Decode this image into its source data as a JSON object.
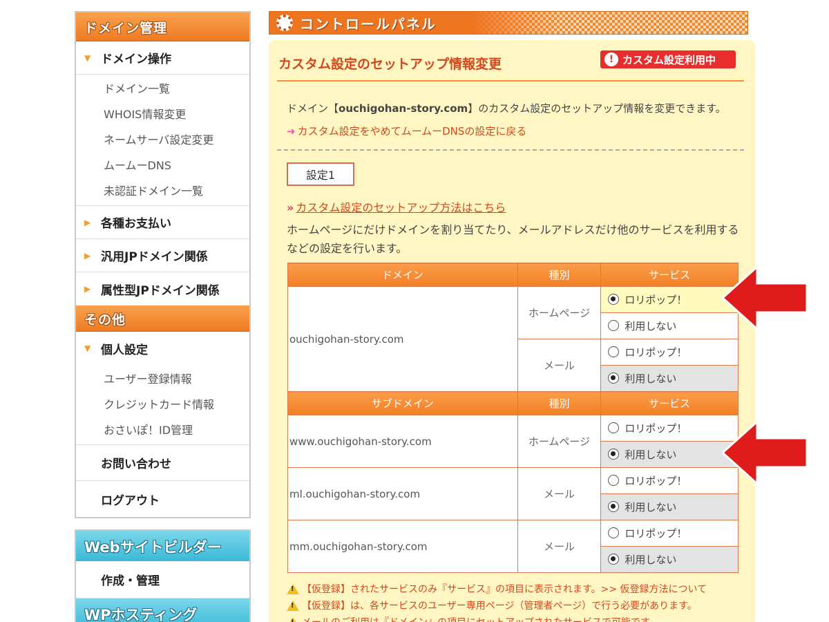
{
  "sidebar": {
    "domain_header": "ドメイン管理",
    "domain_ops": "ドメイン操作",
    "domain_items": [
      "ドメイン一覧",
      "WHOIS情報変更",
      "ネームサーバ設定変更",
      "ムームーDNS",
      "未認証ドメイン一覧"
    ],
    "payments": "各種お支払い",
    "generic_jp": "汎用JPドメイン関係",
    "attr_jp": "属性型JPドメイン関係",
    "other_header": "その他",
    "personal": "個人設定",
    "personal_items": [
      "ユーザー登録情報",
      "クレジットカード情報",
      "おさいぽ！ID管理"
    ],
    "contact": "お問い合わせ",
    "logout": "ログアウト",
    "web_builder_header": "Webサイトビルダー",
    "web_builder_item": "作成・管理",
    "wp_header": "WPホスティング"
  },
  "banner": {
    "title": "コントロールパネル"
  },
  "main": {
    "title": "カスタム設定のセットアップ情報変更",
    "badge": "カスタム設定利用中",
    "desc_prefix": "ドメイン【",
    "desc_domain": "ouchigohan-story.com",
    "desc_suffix": "】のカスタム設定のセットアップ情報を変更できます。",
    "back_link": "カスタム設定をやめてムームーDNSの設定に戻る",
    "tab": "設定1",
    "setup_link": "カスタム設定のセットアップ方法はこちら",
    "note": "ホームページにだけドメインを割り当てたり、メールアドレスだけ他のサービスを利用するなどの設定を行います。"
  },
  "table": {
    "h_domain": "ドメイン",
    "h_kind": "種別",
    "h_service": "サービス",
    "h_subdomain": "サブドメイン",
    "kind_homepage": "ホームページ",
    "kind_mail": "メール",
    "opt_lolipop": "ロリポップ！",
    "opt_none": "利用しない",
    "domain": "ouchigohan-story.com",
    "sub1": "www.ouchigohan-story.com",
    "sub2": "ml.ouchigohan-story.com",
    "sub3": "mm.ouchigohan-story.com"
  },
  "warnings": {
    "w1": "【仮登録】されたサービスのみ『サービス』の項目に表示されます。",
    "w1_link": ">> 仮登録方法について",
    "w2": "【仮登録】は、各サービスのユーザー専用ページ（管理者ページ）で行う必要があります。",
    "w3": "メールのご利用は『ドメイン』の項目にセットアップされたサービスで可能です。"
  },
  "colors": {
    "accent_orange": "#ee7b22",
    "panel_bg": "#fff6c4",
    "red_arrow": "#e01b1b",
    "link": "#d4461b"
  }
}
